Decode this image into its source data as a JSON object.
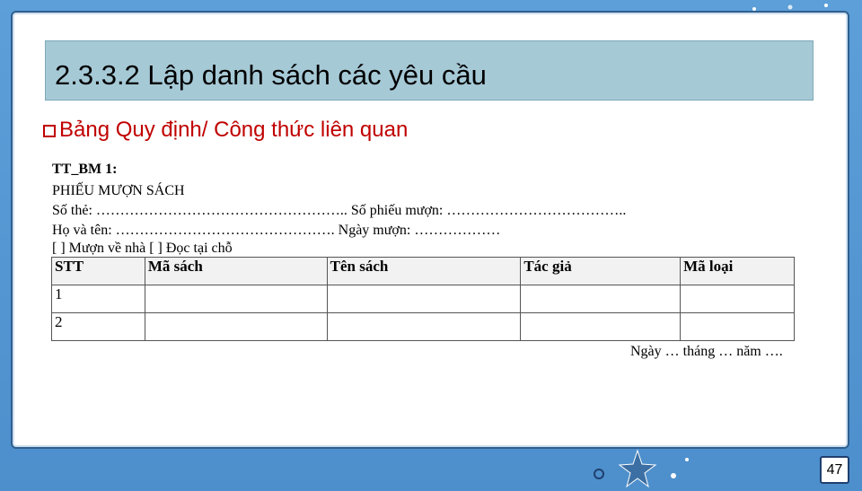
{
  "slide": {
    "title": "2.3.3.2 Lập danh sách các yêu cầu",
    "subtitle": "Bảng Quy định/ Công thức liên quan",
    "page_number": "47"
  },
  "form": {
    "code": "TT_BM 1:",
    "heading": "PHIẾU MƯỢN SÁCH",
    "line1": "Số thẻ: …………………………………………….. Số phiếu mượn: ………………………………..",
    "line2": "Họ và tên: ………………………………………. Ngày mượn: ………………",
    "line3": "[ ] Mượn về nhà [ ] Đọc tại chỗ",
    "table": {
      "headers": [
        "STT",
        "Mã sách",
        "Tên sách",
        "Tác giả",
        "Mã loại"
      ],
      "rows": [
        [
          "1",
          "",
          "",
          "",
          ""
        ],
        [
          "2",
          "",
          "",
          "",
          ""
        ]
      ]
    },
    "date_line": "Ngày … tháng … năm …."
  },
  "colors": {
    "background": "#5b9bd5",
    "title_bar": "#a6c9d6",
    "subtitle": "#c00000"
  }
}
